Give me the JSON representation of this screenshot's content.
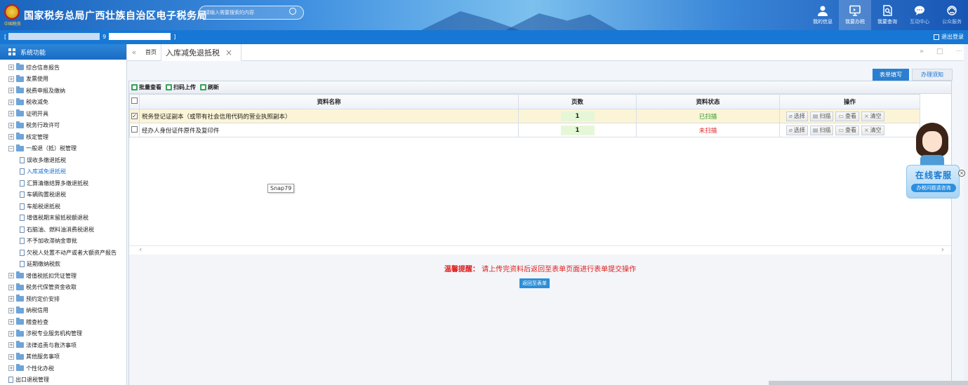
{
  "header": {
    "emblem_text": "中国税务",
    "title": "国家税务总局广西壮族自治区电子税务局",
    "search_placeholder": "请输入需要搜索的内容",
    "nav": [
      {
        "label": "我的信息",
        "icon": "user-icon"
      },
      {
        "label": "我要办税",
        "icon": "monitor-icon"
      },
      {
        "label": "我要查询",
        "icon": "search-doc-icon"
      },
      {
        "label": "互动中心",
        "icon": "chat-icon"
      },
      {
        "label": "公众服务",
        "icon": "service-icon"
      }
    ]
  },
  "userbar": {
    "left_prefix": "[",
    "left_mid": "9",
    "left_suffix": "]",
    "logout": "退出登录"
  },
  "sidebar": {
    "title": "系统功能",
    "items": [
      {
        "label": "综合信息报告",
        "level": 1,
        "expanded": false
      },
      {
        "label": "发票使用",
        "level": 1,
        "expanded": false
      },
      {
        "label": "税费申报及缴纳",
        "level": 1,
        "expanded": false
      },
      {
        "label": "税收减免",
        "level": 1,
        "expanded": false
      },
      {
        "label": "证明开具",
        "level": 1,
        "expanded": false
      },
      {
        "label": "税务行政许可",
        "level": 1,
        "expanded": false
      },
      {
        "label": "核定管理",
        "level": 1,
        "expanded": false
      },
      {
        "label": "一般退（抵）税管理",
        "level": 1,
        "expanded": true
      },
      {
        "label": "误收多缴退抵税",
        "level": 2
      },
      {
        "label": "入库减免退抵税",
        "level": 2,
        "selected": true
      },
      {
        "label": "汇算清缴结算多缴退抵税",
        "level": 2
      },
      {
        "label": "车辆购置税退税",
        "level": 2
      },
      {
        "label": "车船税退抵税",
        "level": 2
      },
      {
        "label": "增值税期末留抵税额退税",
        "level": 2
      },
      {
        "label": "石脑油、燃料油消费税退税",
        "level": 2
      },
      {
        "label": "不予加收滞纳金审批",
        "level": 2
      },
      {
        "label": "欠税人处置不动产或者大额资产报告",
        "level": 2
      },
      {
        "label": "延期缴纳税款",
        "level": 2
      },
      {
        "label": "增值税抵扣凭证管理",
        "level": 1,
        "expanded": false
      },
      {
        "label": "税务代保管资金收取",
        "level": 1,
        "expanded": false
      },
      {
        "label": "预约定价安排",
        "level": 1,
        "expanded": false
      },
      {
        "label": "纳税信用",
        "level": 1,
        "expanded": false
      },
      {
        "label": "稽查检查",
        "level": 1,
        "expanded": false
      },
      {
        "label": "涉税专业服务机构管理",
        "level": 1,
        "expanded": false
      },
      {
        "label": "法律追责与救济事项",
        "level": 1,
        "expanded": false
      },
      {
        "label": "其他服务事项",
        "level": 1,
        "expanded": false
      },
      {
        "label": "个性化办税",
        "level": 1,
        "expanded": false
      },
      {
        "label": "出口退税管理",
        "level": 0
      }
    ]
  },
  "tabs": {
    "home": "首页",
    "active": "入库减免退抵税",
    "close": "×"
  },
  "inner_tabs": {
    "form": "表单填写",
    "notice": "办理须知"
  },
  "toolbar": {
    "batch_view": "批量查看",
    "scan_upload": "扫码上传",
    "refresh": "刷新"
  },
  "table": {
    "headers": {
      "name": "资料名称",
      "pages": "页数",
      "status": "资料状态",
      "ops": "操作"
    },
    "rows": [
      {
        "checked": true,
        "name": "税务登记证副本（或带有社会信用代码的营业执照副本）",
        "pages": "1",
        "status": "已扫描",
        "status_kind": "done"
      },
      {
        "checked": false,
        "name": "经办人身份证件原件及复印件",
        "pages": "1",
        "status": "未扫描",
        "status_kind": "no"
      }
    ],
    "op_labels": {
      "select": "选择",
      "scan": "扫描",
      "view": "查看",
      "clear": "清空"
    }
  },
  "tooltip": "Snap79",
  "reminder": {
    "label": "温馨提醒：",
    "text": "请上传完资料后返回至表单页面进行表单提交操作"
  },
  "back_button": "返回至表单",
  "customer_service": {
    "title": "在线客服",
    "subtitle": "办税问题请咨询",
    "close": "×"
  }
}
